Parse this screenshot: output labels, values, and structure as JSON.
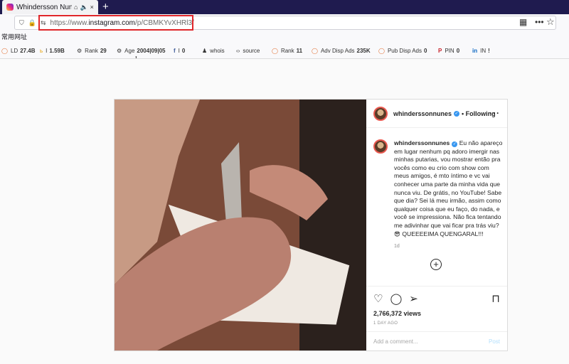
{
  "browser": {
    "tab_title": "Whindersson Nunes",
    "url_prefix": "https://www.",
    "url_domain": "instagram.com",
    "url_path": "/p/CBMKYvXHRl3/",
    "bookmarks_label": "常用网址"
  },
  "seo": [
    {
      "key": "LD",
      "val": "27.4B"
    },
    {
      "key": "I",
      "val": "1.59B"
    },
    {
      "key": "Rank",
      "val": "29"
    },
    {
      "key": "Age",
      "val": "2004|09|05"
    },
    {
      "key": "I",
      "val": "0"
    },
    {
      "key": "whois",
      "val": ""
    },
    {
      "key": "source",
      "val": ""
    },
    {
      "key": "Rank",
      "val": "11"
    },
    {
      "key": "Adv Disp Ads",
      "val": "235K"
    },
    {
      "key": "Pub Disp Ads",
      "val": "0"
    },
    {
      "key": "PIN",
      "val": "0"
    },
    {
      "key": "IN",
      "val": "!"
    }
  ],
  "post": {
    "username": "whinderssonnunes",
    "following": "• Following",
    "caption": "Eu não apareço em lugar nenhum pq adoro imergir nas minhas putarias, vou mostrar então pra vocês como eu crio com show com meus amigos, é mto íntimo e vc vai conhecer uma parte da minha vida que nunca viu. De grátis, no YouTube! Sabe que dia? Sei lá meu irmão, assim como qualquer coisa que eu faço, do nada, e você se impressiona. Não fica tentando me adivinhar que vai ficar pra trás viu? 😎 QUEEEEIMA QUENGARAL!!!",
    "caption_age": "1d",
    "views": "2,766,372 views",
    "day_ago": "1 DAY AGO",
    "comment_placeholder": "Add a comment...",
    "post_label": "Post"
  }
}
